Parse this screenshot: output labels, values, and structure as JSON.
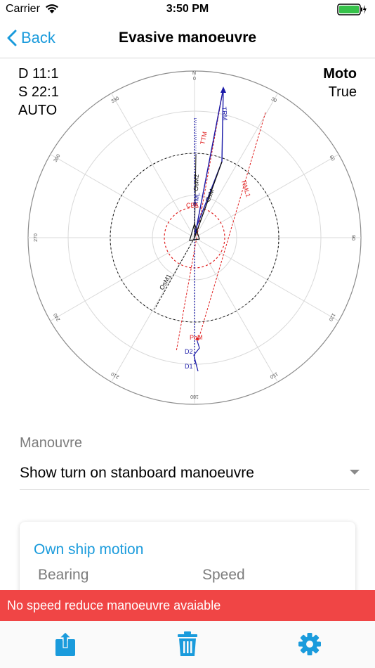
{
  "status": {
    "carrier": "Carrier",
    "time": "3:50 PM"
  },
  "nav": {
    "back_label": "Back",
    "title": "Evasive manoeuvre"
  },
  "info_left": {
    "line1": "D 11:1",
    "line2": "S 22:1",
    "line3": "AUTO"
  },
  "info_right": {
    "mode": "Moto",
    "ref": "True"
  },
  "plot": {
    "bearing_labels": [
      {
        "deg": 0,
        "text": "0"
      },
      {
        "deg": 30,
        "text": "30"
      },
      {
        "deg": 60,
        "text": "60"
      },
      {
        "deg": 90,
        "text": "90"
      },
      {
        "deg": 120,
        "text": "120"
      },
      {
        "deg": 150,
        "text": "150"
      },
      {
        "deg": 180,
        "text": "180"
      },
      {
        "deg": 210,
        "text": "210"
      },
      {
        "deg": 240,
        "text": "240"
      },
      {
        "deg": 270,
        "text": "270"
      },
      {
        "deg": 300,
        "text": "300"
      },
      {
        "deg": 330,
        "text": "330"
      }
    ],
    "north_label": "N",
    "vector_labels": {
      "trm": "TRM",
      "ttm": "TTM",
      "osm2": "OsM2",
      "osm": "OsM",
      "rml": "RML",
      "rml1": "RML1",
      "cpa": "CPA",
      "osm1": "OsM1",
      "pom": "PoM",
      "d2": "D2",
      "d1": "D1"
    },
    "colors": {
      "blue": "#1a1aa8",
      "red": "#e02020",
      "black": "#111111",
      "grid": "#d9d9d9",
      "ring": "#8c8c8c"
    }
  },
  "manouvre": {
    "label": "Manouvre",
    "value": "Show turn on stanboard manoeuvre"
  },
  "card": {
    "title": "Own ship motion",
    "bearing": "Bearing",
    "speed": "Speed"
  },
  "banner": {
    "text": "No speed reduce manoeuvre avaiable"
  },
  "theme": {
    "accent": "#1a9bdc",
    "banner": "#f04545"
  }
}
